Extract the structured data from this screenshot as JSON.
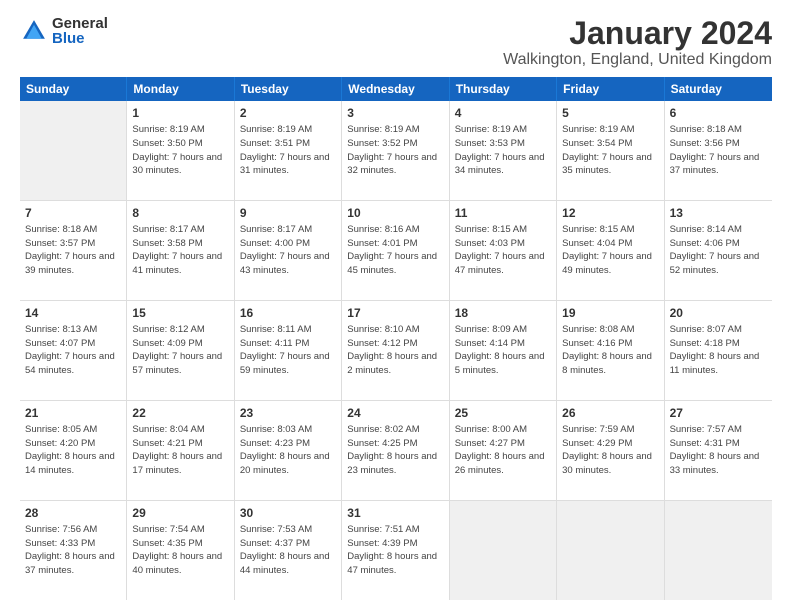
{
  "logo": {
    "general": "General",
    "blue": "Blue"
  },
  "title": "January 2024",
  "subtitle": "Walkington, England, United Kingdom",
  "days_of_week": [
    "Sunday",
    "Monday",
    "Tuesday",
    "Wednesday",
    "Thursday",
    "Friday",
    "Saturday"
  ],
  "weeks": [
    [
      {
        "day": "",
        "sunrise": "",
        "sunset": "",
        "daylight": "",
        "empty": true
      },
      {
        "day": "1",
        "sunrise": "Sunrise: 8:19 AM",
        "sunset": "Sunset: 3:50 PM",
        "daylight": "Daylight: 7 hours and 30 minutes."
      },
      {
        "day": "2",
        "sunrise": "Sunrise: 8:19 AM",
        "sunset": "Sunset: 3:51 PM",
        "daylight": "Daylight: 7 hours and 31 minutes."
      },
      {
        "day": "3",
        "sunrise": "Sunrise: 8:19 AM",
        "sunset": "Sunset: 3:52 PM",
        "daylight": "Daylight: 7 hours and 32 minutes."
      },
      {
        "day": "4",
        "sunrise": "Sunrise: 8:19 AM",
        "sunset": "Sunset: 3:53 PM",
        "daylight": "Daylight: 7 hours and 34 minutes."
      },
      {
        "day": "5",
        "sunrise": "Sunrise: 8:19 AM",
        "sunset": "Sunset: 3:54 PM",
        "daylight": "Daylight: 7 hours and 35 minutes."
      },
      {
        "day": "6",
        "sunrise": "Sunrise: 8:18 AM",
        "sunset": "Sunset: 3:56 PM",
        "daylight": "Daylight: 7 hours and 37 minutes."
      }
    ],
    [
      {
        "day": "7",
        "sunrise": "Sunrise: 8:18 AM",
        "sunset": "Sunset: 3:57 PM",
        "daylight": "Daylight: 7 hours and 39 minutes."
      },
      {
        "day": "8",
        "sunrise": "Sunrise: 8:17 AM",
        "sunset": "Sunset: 3:58 PM",
        "daylight": "Daylight: 7 hours and 41 minutes."
      },
      {
        "day": "9",
        "sunrise": "Sunrise: 8:17 AM",
        "sunset": "Sunset: 4:00 PM",
        "daylight": "Daylight: 7 hours and 43 minutes."
      },
      {
        "day": "10",
        "sunrise": "Sunrise: 8:16 AM",
        "sunset": "Sunset: 4:01 PM",
        "daylight": "Daylight: 7 hours and 45 minutes."
      },
      {
        "day": "11",
        "sunrise": "Sunrise: 8:15 AM",
        "sunset": "Sunset: 4:03 PM",
        "daylight": "Daylight: 7 hours and 47 minutes."
      },
      {
        "day": "12",
        "sunrise": "Sunrise: 8:15 AM",
        "sunset": "Sunset: 4:04 PM",
        "daylight": "Daylight: 7 hours and 49 minutes."
      },
      {
        "day": "13",
        "sunrise": "Sunrise: 8:14 AM",
        "sunset": "Sunset: 4:06 PM",
        "daylight": "Daylight: 7 hours and 52 minutes."
      }
    ],
    [
      {
        "day": "14",
        "sunrise": "Sunrise: 8:13 AM",
        "sunset": "Sunset: 4:07 PM",
        "daylight": "Daylight: 7 hours and 54 minutes."
      },
      {
        "day": "15",
        "sunrise": "Sunrise: 8:12 AM",
        "sunset": "Sunset: 4:09 PM",
        "daylight": "Daylight: 7 hours and 57 minutes."
      },
      {
        "day": "16",
        "sunrise": "Sunrise: 8:11 AM",
        "sunset": "Sunset: 4:11 PM",
        "daylight": "Daylight: 7 hours and 59 minutes."
      },
      {
        "day": "17",
        "sunrise": "Sunrise: 8:10 AM",
        "sunset": "Sunset: 4:12 PM",
        "daylight": "Daylight: 8 hours and 2 minutes."
      },
      {
        "day": "18",
        "sunrise": "Sunrise: 8:09 AM",
        "sunset": "Sunset: 4:14 PM",
        "daylight": "Daylight: 8 hours and 5 minutes."
      },
      {
        "day": "19",
        "sunrise": "Sunrise: 8:08 AM",
        "sunset": "Sunset: 4:16 PM",
        "daylight": "Daylight: 8 hours and 8 minutes."
      },
      {
        "day": "20",
        "sunrise": "Sunrise: 8:07 AM",
        "sunset": "Sunset: 4:18 PM",
        "daylight": "Daylight: 8 hours and 11 minutes."
      }
    ],
    [
      {
        "day": "21",
        "sunrise": "Sunrise: 8:05 AM",
        "sunset": "Sunset: 4:20 PM",
        "daylight": "Daylight: 8 hours and 14 minutes."
      },
      {
        "day": "22",
        "sunrise": "Sunrise: 8:04 AM",
        "sunset": "Sunset: 4:21 PM",
        "daylight": "Daylight: 8 hours and 17 minutes."
      },
      {
        "day": "23",
        "sunrise": "Sunrise: 8:03 AM",
        "sunset": "Sunset: 4:23 PM",
        "daylight": "Daylight: 8 hours and 20 minutes."
      },
      {
        "day": "24",
        "sunrise": "Sunrise: 8:02 AM",
        "sunset": "Sunset: 4:25 PM",
        "daylight": "Daylight: 8 hours and 23 minutes."
      },
      {
        "day": "25",
        "sunrise": "Sunrise: 8:00 AM",
        "sunset": "Sunset: 4:27 PM",
        "daylight": "Daylight: 8 hours and 26 minutes."
      },
      {
        "day": "26",
        "sunrise": "Sunrise: 7:59 AM",
        "sunset": "Sunset: 4:29 PM",
        "daylight": "Daylight: 8 hours and 30 minutes."
      },
      {
        "day": "27",
        "sunrise": "Sunrise: 7:57 AM",
        "sunset": "Sunset: 4:31 PM",
        "daylight": "Daylight: 8 hours and 33 minutes."
      }
    ],
    [
      {
        "day": "28",
        "sunrise": "Sunrise: 7:56 AM",
        "sunset": "Sunset: 4:33 PM",
        "daylight": "Daylight: 8 hours and 37 minutes."
      },
      {
        "day": "29",
        "sunrise": "Sunrise: 7:54 AM",
        "sunset": "Sunset: 4:35 PM",
        "daylight": "Daylight: 8 hours and 40 minutes."
      },
      {
        "day": "30",
        "sunrise": "Sunrise: 7:53 AM",
        "sunset": "Sunset: 4:37 PM",
        "daylight": "Daylight: 8 hours and 44 minutes."
      },
      {
        "day": "31",
        "sunrise": "Sunrise: 7:51 AM",
        "sunset": "Sunset: 4:39 PM",
        "daylight": "Daylight: 8 hours and 47 minutes."
      },
      {
        "day": "",
        "sunrise": "",
        "sunset": "",
        "daylight": "",
        "empty": true
      },
      {
        "day": "",
        "sunrise": "",
        "sunset": "",
        "daylight": "",
        "empty": true
      },
      {
        "day": "",
        "sunrise": "",
        "sunset": "",
        "daylight": "",
        "empty": true
      }
    ]
  ]
}
